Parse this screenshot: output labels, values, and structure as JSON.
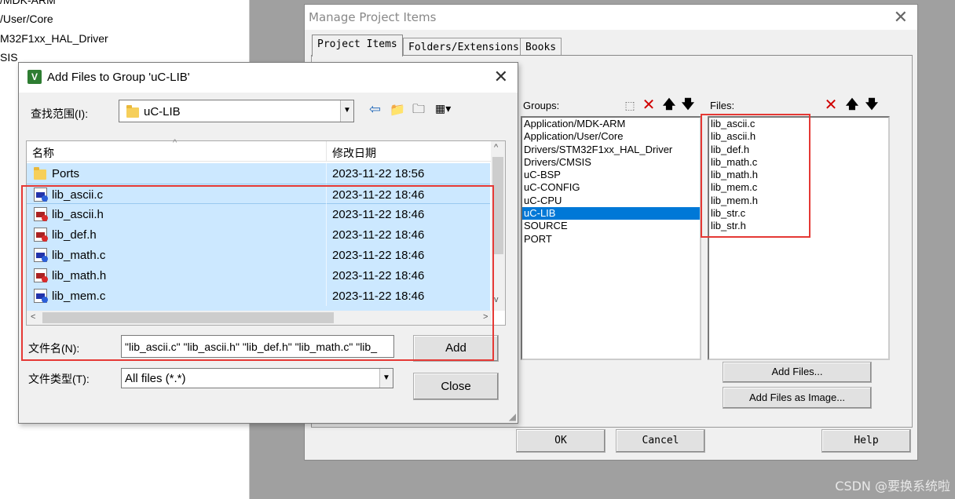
{
  "background_tree": {
    "items": [
      "/MDK-ARM",
      "/User/Core",
      "M32F1xx_HAL_Driver",
      "SIS"
    ]
  },
  "manage_dialog": {
    "title": "Manage Project Items",
    "tabs": [
      {
        "label": "Project Items",
        "active": true
      },
      {
        "label": "Folders/Extensions",
        "active": false
      },
      {
        "label": "Books",
        "active": false
      }
    ],
    "groups_label": "Groups:",
    "groups": [
      "Application/MDK-ARM",
      "Application/User/Core",
      "Drivers/STM32F1xx_HAL_Driver",
      "Drivers/CMSIS",
      "uC-BSP",
      "uC-CONFIG",
      "uC-CPU",
      "uC-LIB",
      "SOURCE",
      "PORT"
    ],
    "selected_group": "uC-LIB",
    "files_label": "Files:",
    "files": [
      "lib_ascii.c",
      "lib_ascii.h",
      "lib_def.h",
      "lib_math.c",
      "lib_math.h",
      "lib_mem.c",
      "lib_mem.h",
      "lib_str.c",
      "lib_str.h"
    ],
    "add_files_label": "Add Files...",
    "add_files_image_label": "Add Files as Image...",
    "ok_label": "OK",
    "cancel_label": "Cancel",
    "help_label": "Help"
  },
  "add_dialog": {
    "title": "Add Files to Group 'uC-LIB'",
    "look_in_label": "查找范围(I):",
    "look_in_value": "uC-LIB",
    "col_name": "名称",
    "col_date": "修改日期",
    "rows": [
      {
        "name": "Ports",
        "date": "2023-11-22 18:56",
        "icon": "folder-icon"
      },
      {
        "name": "lib_ascii.c",
        "date": "2023-11-22 18:46",
        "icon": "c-file-icon"
      },
      {
        "name": "lib_ascii.h",
        "date": "2023-11-22 18:46",
        "icon": "h-file-icon"
      },
      {
        "name": "lib_def.h",
        "date": "2023-11-22 18:46",
        "icon": "h-file-icon"
      },
      {
        "name": "lib_math.c",
        "date": "2023-11-22 18:46",
        "icon": "c-file-icon"
      },
      {
        "name": "lib_math.h",
        "date": "2023-11-22 18:46",
        "icon": "h-file-icon"
      },
      {
        "name": "lib_mem.c",
        "date": "2023-11-22 18:46",
        "icon": "c-file-icon"
      }
    ],
    "filename_label": "文件名(N):",
    "filename_value": "\"lib_ascii.c\" \"lib_ascii.h\" \"lib_def.h\" \"lib_math.c\" \"lib_",
    "filetype_label": "文件类型(T):",
    "filetype_value": "All files (*.*)",
    "add_label": "Add",
    "close_label": "Close"
  },
  "watermark": "CSDN @要换系统啦",
  "colors": {
    "selection": "#cce8ff",
    "highlight": "#0078d7",
    "annotation_red": "#e53935"
  }
}
